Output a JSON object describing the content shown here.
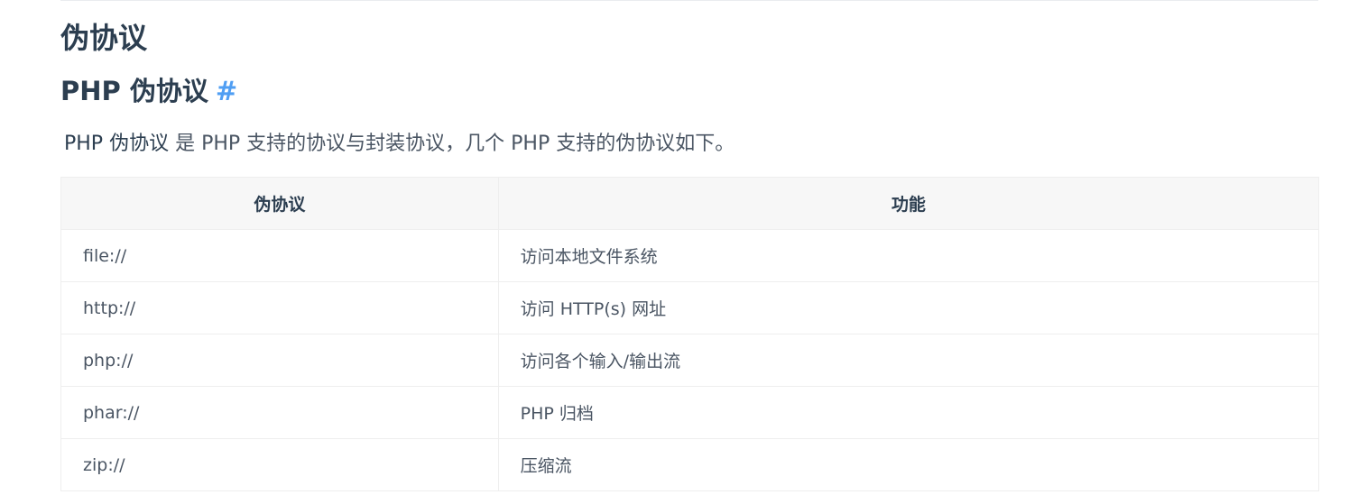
{
  "heading1": "伪协议",
  "heading2": {
    "text": "PHP 伪协议",
    "anchor": "#"
  },
  "paragraph": {
    "term": "PHP 伪协议",
    "rest": " 是 PHP 支持的协议与封装协议，几个 PHP 支持的伪协议如下。"
  },
  "table": {
    "headers": [
      "伪协议",
      "功能"
    ],
    "rows": [
      [
        "file://",
        "访问本地文件系统"
      ],
      [
        "http://",
        "访问 HTTP(s) 网址"
      ],
      [
        "php://",
        "访问各个输入/输出流"
      ],
      [
        "phar://",
        "PHP 归档"
      ],
      [
        "zip://",
        "压缩流"
      ]
    ]
  },
  "colors": {
    "heading": "#2c3e50",
    "text": "#4a5563",
    "anchor": "#4f9ef3",
    "header_bg": "#f7f7f7",
    "border": "#eeeeee"
  }
}
